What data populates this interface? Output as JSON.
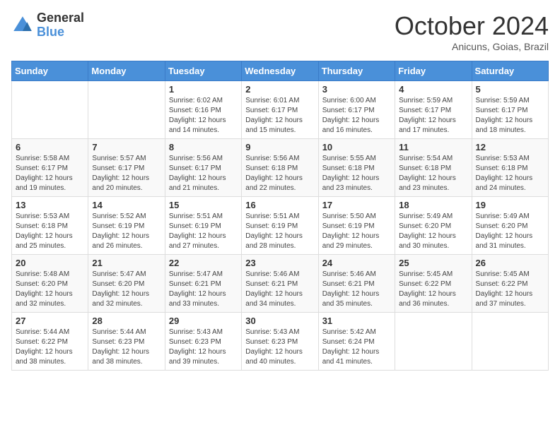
{
  "header": {
    "logo_general": "General",
    "logo_blue": "Blue",
    "month_title": "October 2024",
    "location": "Anicuns, Goias, Brazil"
  },
  "weekdays": [
    "Sunday",
    "Monday",
    "Tuesday",
    "Wednesday",
    "Thursday",
    "Friday",
    "Saturday"
  ],
  "weeks": [
    [
      {
        "day": "",
        "sunrise": "",
        "sunset": "",
        "daylight": ""
      },
      {
        "day": "",
        "sunrise": "",
        "sunset": "",
        "daylight": ""
      },
      {
        "day": "1",
        "sunrise": "Sunrise: 6:02 AM",
        "sunset": "Sunset: 6:16 PM",
        "daylight": "Daylight: 12 hours and 14 minutes."
      },
      {
        "day": "2",
        "sunrise": "Sunrise: 6:01 AM",
        "sunset": "Sunset: 6:17 PM",
        "daylight": "Daylight: 12 hours and 15 minutes."
      },
      {
        "day": "3",
        "sunrise": "Sunrise: 6:00 AM",
        "sunset": "Sunset: 6:17 PM",
        "daylight": "Daylight: 12 hours and 16 minutes."
      },
      {
        "day": "4",
        "sunrise": "Sunrise: 5:59 AM",
        "sunset": "Sunset: 6:17 PM",
        "daylight": "Daylight: 12 hours and 17 minutes."
      },
      {
        "day": "5",
        "sunrise": "Sunrise: 5:59 AM",
        "sunset": "Sunset: 6:17 PM",
        "daylight": "Daylight: 12 hours and 18 minutes."
      }
    ],
    [
      {
        "day": "6",
        "sunrise": "Sunrise: 5:58 AM",
        "sunset": "Sunset: 6:17 PM",
        "daylight": "Daylight: 12 hours and 19 minutes."
      },
      {
        "day": "7",
        "sunrise": "Sunrise: 5:57 AM",
        "sunset": "Sunset: 6:17 PM",
        "daylight": "Daylight: 12 hours and 20 minutes."
      },
      {
        "day": "8",
        "sunrise": "Sunrise: 5:56 AM",
        "sunset": "Sunset: 6:17 PM",
        "daylight": "Daylight: 12 hours and 21 minutes."
      },
      {
        "day": "9",
        "sunrise": "Sunrise: 5:56 AM",
        "sunset": "Sunset: 6:18 PM",
        "daylight": "Daylight: 12 hours and 22 minutes."
      },
      {
        "day": "10",
        "sunrise": "Sunrise: 5:55 AM",
        "sunset": "Sunset: 6:18 PM",
        "daylight": "Daylight: 12 hours and 23 minutes."
      },
      {
        "day": "11",
        "sunrise": "Sunrise: 5:54 AM",
        "sunset": "Sunset: 6:18 PM",
        "daylight": "Daylight: 12 hours and 23 minutes."
      },
      {
        "day": "12",
        "sunrise": "Sunrise: 5:53 AM",
        "sunset": "Sunset: 6:18 PM",
        "daylight": "Daylight: 12 hours and 24 minutes."
      }
    ],
    [
      {
        "day": "13",
        "sunrise": "Sunrise: 5:53 AM",
        "sunset": "Sunset: 6:18 PM",
        "daylight": "Daylight: 12 hours and 25 minutes."
      },
      {
        "day": "14",
        "sunrise": "Sunrise: 5:52 AM",
        "sunset": "Sunset: 6:19 PM",
        "daylight": "Daylight: 12 hours and 26 minutes."
      },
      {
        "day": "15",
        "sunrise": "Sunrise: 5:51 AM",
        "sunset": "Sunset: 6:19 PM",
        "daylight": "Daylight: 12 hours and 27 minutes."
      },
      {
        "day": "16",
        "sunrise": "Sunrise: 5:51 AM",
        "sunset": "Sunset: 6:19 PM",
        "daylight": "Daylight: 12 hours and 28 minutes."
      },
      {
        "day": "17",
        "sunrise": "Sunrise: 5:50 AM",
        "sunset": "Sunset: 6:19 PM",
        "daylight": "Daylight: 12 hours and 29 minutes."
      },
      {
        "day": "18",
        "sunrise": "Sunrise: 5:49 AM",
        "sunset": "Sunset: 6:20 PM",
        "daylight": "Daylight: 12 hours and 30 minutes."
      },
      {
        "day": "19",
        "sunrise": "Sunrise: 5:49 AM",
        "sunset": "Sunset: 6:20 PM",
        "daylight": "Daylight: 12 hours and 31 minutes."
      }
    ],
    [
      {
        "day": "20",
        "sunrise": "Sunrise: 5:48 AM",
        "sunset": "Sunset: 6:20 PM",
        "daylight": "Daylight: 12 hours and 32 minutes."
      },
      {
        "day": "21",
        "sunrise": "Sunrise: 5:47 AM",
        "sunset": "Sunset: 6:20 PM",
        "daylight": "Daylight: 12 hours and 32 minutes."
      },
      {
        "day": "22",
        "sunrise": "Sunrise: 5:47 AM",
        "sunset": "Sunset: 6:21 PM",
        "daylight": "Daylight: 12 hours and 33 minutes."
      },
      {
        "day": "23",
        "sunrise": "Sunrise: 5:46 AM",
        "sunset": "Sunset: 6:21 PM",
        "daylight": "Daylight: 12 hours and 34 minutes."
      },
      {
        "day": "24",
        "sunrise": "Sunrise: 5:46 AM",
        "sunset": "Sunset: 6:21 PM",
        "daylight": "Daylight: 12 hours and 35 minutes."
      },
      {
        "day": "25",
        "sunrise": "Sunrise: 5:45 AM",
        "sunset": "Sunset: 6:22 PM",
        "daylight": "Daylight: 12 hours and 36 minutes."
      },
      {
        "day": "26",
        "sunrise": "Sunrise: 5:45 AM",
        "sunset": "Sunset: 6:22 PM",
        "daylight": "Daylight: 12 hours and 37 minutes."
      }
    ],
    [
      {
        "day": "27",
        "sunrise": "Sunrise: 5:44 AM",
        "sunset": "Sunset: 6:22 PM",
        "daylight": "Daylight: 12 hours and 38 minutes."
      },
      {
        "day": "28",
        "sunrise": "Sunrise: 5:44 AM",
        "sunset": "Sunset: 6:23 PM",
        "daylight": "Daylight: 12 hours and 38 minutes."
      },
      {
        "day": "29",
        "sunrise": "Sunrise: 5:43 AM",
        "sunset": "Sunset: 6:23 PM",
        "daylight": "Daylight: 12 hours and 39 minutes."
      },
      {
        "day": "30",
        "sunrise": "Sunrise: 5:43 AM",
        "sunset": "Sunset: 6:23 PM",
        "daylight": "Daylight: 12 hours and 40 minutes."
      },
      {
        "day": "31",
        "sunrise": "Sunrise: 5:42 AM",
        "sunset": "Sunset: 6:24 PM",
        "daylight": "Daylight: 12 hours and 41 minutes."
      },
      {
        "day": "",
        "sunrise": "",
        "sunset": "",
        "daylight": ""
      },
      {
        "day": "",
        "sunrise": "",
        "sunset": "",
        "daylight": ""
      }
    ]
  ]
}
